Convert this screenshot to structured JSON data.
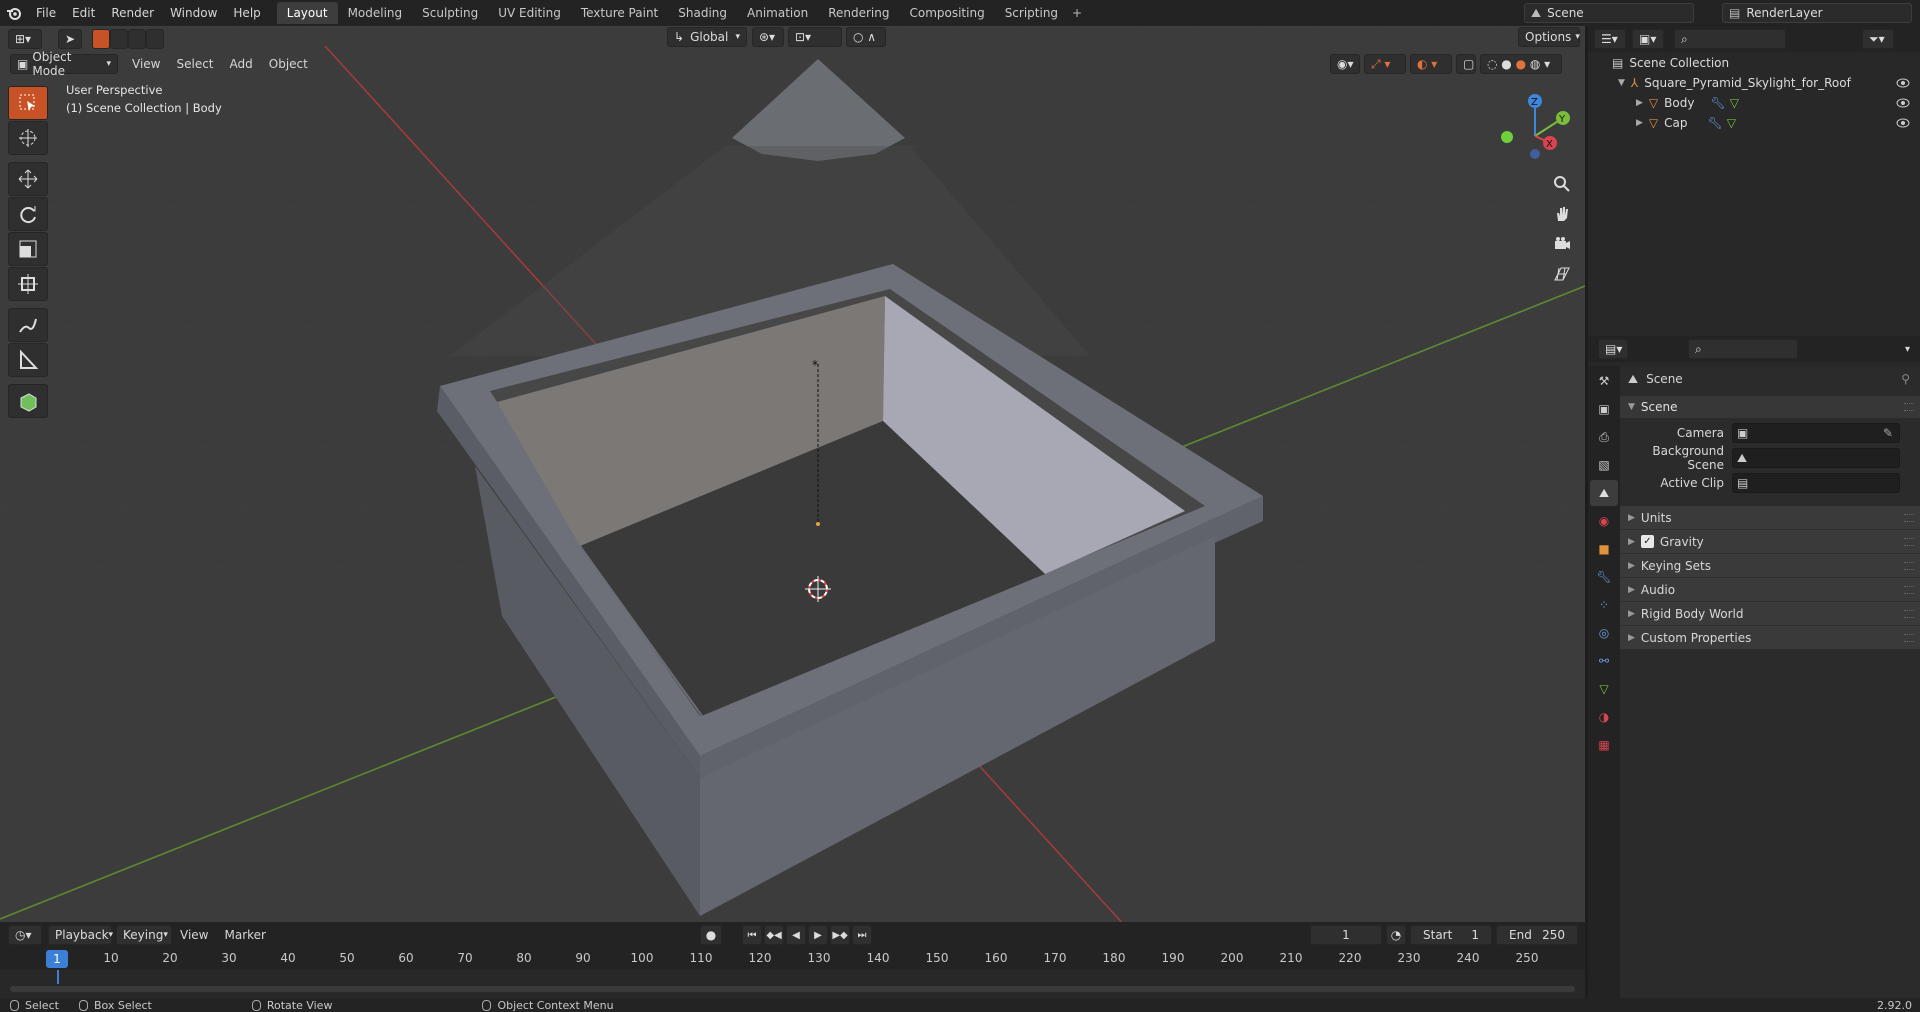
{
  "topbar": {
    "menus": [
      "File",
      "Edit",
      "Render",
      "Window",
      "Help"
    ],
    "workspaces": [
      "Layout",
      "Modeling",
      "Sculpting",
      "UV Editing",
      "Texture Paint",
      "Shading",
      "Animation",
      "Rendering",
      "Compositing",
      "Scripting"
    ],
    "active_workspace": "Layout",
    "scene_name": "Scene",
    "view_layer": "RenderLayer"
  },
  "viewport": {
    "mode": "Object Mode",
    "menus": [
      "View",
      "Select",
      "Add",
      "Object"
    ],
    "orientation": "Global",
    "options_label": "Options",
    "perspective_label": "User Perspective",
    "collection_label": "(1) Scene Collection | Body",
    "gizmo_axes": {
      "x": "X",
      "y": "Y",
      "z": "Z"
    }
  },
  "outliner": {
    "root": "Scene Collection",
    "object": "Square_Pyramid_Skylight_for_Roof",
    "children": [
      "Body",
      "Cap"
    ]
  },
  "properties": {
    "context": "Scene",
    "panel": "Scene",
    "fields": [
      {
        "label": "Camera",
        "value": ""
      },
      {
        "label": "Background Scene",
        "value": ""
      },
      {
        "label": "Active Clip",
        "value": ""
      }
    ],
    "subpanels": [
      "Units",
      "Gravity",
      "Keying Sets",
      "Audio",
      "Rigid Body World",
      "Custom Properties"
    ],
    "gravity_checked": true
  },
  "timeline": {
    "menus": [
      "Playback",
      "Keying",
      "View",
      "Marker"
    ],
    "current_frame": "1",
    "start_label": "Start",
    "start": "1",
    "end_label": "End",
    "end": "250",
    "ticks": [
      "10",
      "20",
      "30",
      "40",
      "50",
      "60",
      "70",
      "80",
      "90",
      "100",
      "110",
      "120",
      "130",
      "140",
      "150",
      "160",
      "170",
      "180",
      "190",
      "200",
      "210",
      "220",
      "230",
      "240",
      "250"
    ],
    "playhead": "1"
  },
  "statusbar": {
    "select": "Select",
    "box_select": "Box Select",
    "rotate_view": "Rotate View",
    "context_menu": "Object Context Menu",
    "version": "2.92.0"
  },
  "colors": {
    "accent_orange": "#c65225",
    "selection_blue": "#3b7fd6",
    "axis_x": "#d9444f",
    "axis_y": "#7bbd3a",
    "axis_z": "#3f86dd"
  }
}
